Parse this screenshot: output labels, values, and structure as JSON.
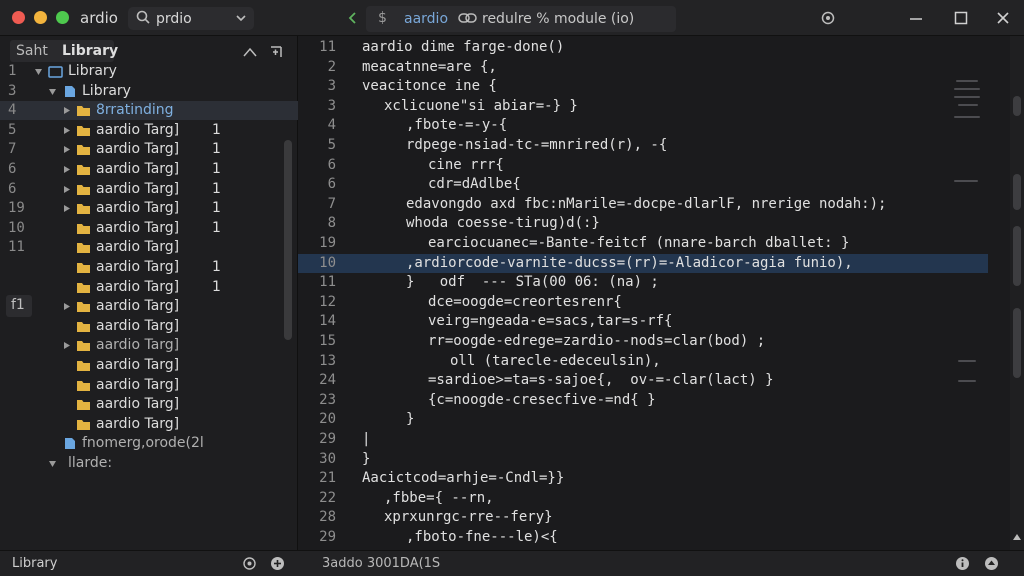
{
  "titlebar": {
    "app_name": "ardio",
    "search_value": "prdio",
    "tab_name": "aardio",
    "tab_description": "redulre % module (io)"
  },
  "sidebar": {
    "title_prefix": "Saht",
    "title": "Library",
    "marker": "f1",
    "rows": [
      {
        "num": "1",
        "label": "Library",
        "count": "",
        "indent": 0,
        "arrow": "down",
        "icon": "library-icon",
        "style": "normal"
      },
      {
        "num": "3",
        "label": "Library",
        "count": "",
        "indent": 1,
        "arrow": "down",
        "icon": "module-icon",
        "style": "normal"
      },
      {
        "num": "4",
        "label": "8rratinding",
        "count": "",
        "indent": 2,
        "arrow": "right",
        "icon": "folder-icon",
        "style": "blue"
      },
      {
        "num": "5",
        "label": "aardio Targ]",
        "count": "1",
        "indent": 2,
        "arrow": "right",
        "icon": "folder-icon",
        "style": "normal"
      },
      {
        "num": "7",
        "label": "aardio Targ]",
        "count": "1",
        "indent": 2,
        "arrow": "right",
        "icon": "folder-icon",
        "style": "normal"
      },
      {
        "num": "6",
        "label": "aardio Targ]",
        "count": "1",
        "indent": 2,
        "arrow": "right",
        "icon": "folder-icon",
        "style": "normal"
      },
      {
        "num": "6",
        "label": "aardio Targ]",
        "count": "1",
        "indent": 2,
        "arrow": "right",
        "icon": "folder-icon",
        "style": "normal"
      },
      {
        "num": "19",
        "label": "aardio Targ]",
        "count": "1",
        "indent": 2,
        "arrow": "right",
        "icon": "folder-icon",
        "style": "normal"
      },
      {
        "num": "10",
        "label": "aardio Targ]",
        "count": "1",
        "indent": 2,
        "arrow": "",
        "icon": "folder-icon",
        "style": "normal"
      },
      {
        "num": "11",
        "label": "aardio Targ]",
        "count": "",
        "indent": 2,
        "arrow": "",
        "icon": "folder-icon",
        "style": "normal"
      },
      {
        "num": "",
        "label": "aardio Targ]",
        "count": "1",
        "indent": 2,
        "arrow": "",
        "icon": "folder-icon",
        "style": "normal"
      },
      {
        "num": "",
        "label": "aardio Targ]",
        "count": "1",
        "indent": 2,
        "arrow": "",
        "icon": "folder-icon",
        "style": "normal"
      },
      {
        "num": "",
        "label": "aardio Targ]",
        "count": "",
        "indent": 2,
        "arrow": "right",
        "icon": "folder-icon",
        "style": "normal"
      },
      {
        "num": "",
        "label": "aardio Targ]",
        "count": "",
        "indent": 2,
        "arrow": "",
        "icon": "folder-icon",
        "style": "normal"
      },
      {
        "num": "",
        "label": "aardio Targ]",
        "count": "",
        "indent": 2,
        "arrow": "right",
        "icon": "folder-icon",
        "style": "dim"
      },
      {
        "num": "",
        "label": "aardio Targ]",
        "count": "",
        "indent": 2,
        "arrow": "",
        "icon": "folder-icon",
        "style": "normal"
      },
      {
        "num": "",
        "label": "aardio Targ]",
        "count": "",
        "indent": 2,
        "arrow": "",
        "icon": "folder-icon",
        "style": "normal"
      },
      {
        "num": "",
        "label": "aardio Targ]",
        "count": "",
        "indent": 2,
        "arrow": "",
        "icon": "folder-icon",
        "style": "normal"
      },
      {
        "num": "",
        "label": "aardio Targ]",
        "count": "",
        "indent": 2,
        "arrow": "",
        "icon": "folder-icon",
        "style": "normal"
      },
      {
        "num": "",
        "label": "fnomerg,orode(2l",
        "count": "",
        "indent": 1,
        "arrow": "",
        "icon": "module-icon",
        "style": "dim"
      },
      {
        "num": "",
        "label": "llarde:",
        "count": "",
        "indent": 1,
        "arrow": "down",
        "icon": "",
        "style": "dim"
      }
    ]
  },
  "editor": {
    "lines": [
      {
        "num": "11",
        "indent": 0,
        "text": "aardio dime farge-done()",
        "kind": "normal"
      },
      {
        "num": "2",
        "indent": 0,
        "text": "meacatnne=are {,",
        "kind": "kw"
      },
      {
        "num": "3",
        "indent": 0,
        "text": "veacitonce ine {",
        "kind": "normal"
      },
      {
        "num": "3",
        "indent": 1,
        "text": "xclicuone\"si abiar=-} }",
        "kind": "normal"
      },
      {
        "num": "4",
        "indent": 2,
        "text": ",fbote-=-y-{",
        "kind": "normal"
      },
      {
        "num": "5",
        "indent": 2,
        "text": "rdpege-nsiad-tc-=mnrired(r), -{",
        "kind": "normal"
      },
      {
        "num": "6",
        "indent": 3,
        "text": "cine rrr{",
        "kind": "normal"
      },
      {
        "num": "6",
        "indent": 3,
        "text": "cdr=dAdlbe{",
        "kind": "normal"
      },
      {
        "num": "7",
        "indent": 2,
        "text": "edavongdo axd fbc:nMarile=-docpe-dlarlF, nrerige nodah:);",
        "kind": "normal"
      },
      {
        "num": "8",
        "indent": 2,
        "text": "whoda coesse-tirug)d(:}",
        "kind": "normal"
      },
      {
        "num": "19",
        "indent": 3,
        "text": "earciocuanec=-Bante-feitcf (nnare-barch dballet: }",
        "kind": "fn"
      },
      {
        "num": "10",
        "indent": 2,
        "text": ",ardiorcode-varnite-ducss=(rr)=-Aladicor-agia funio),",
        "kind": "hl"
      },
      {
        "num": "11",
        "indent": 2,
        "text": "}   odf  --- STa(00 06: (na) ;",
        "kind": "normal"
      },
      {
        "num": "12",
        "indent": 3,
        "text": "dce=oogde=creortesrenr{",
        "kind": "normal"
      },
      {
        "num": "14",
        "indent": 3,
        "text": "veirg=ngeada-e=sacs,tar=s-rf{",
        "kind": "normal"
      },
      {
        "num": "15",
        "indent": 3,
        "text": "rr=oogde-edrege=zardio--nods=clar(bod) ;",
        "kind": "normal"
      },
      {
        "num": "13",
        "indent": 4,
        "text": "oll (tarecle-edeceulsin),",
        "kind": "normal"
      },
      {
        "num": "24",
        "indent": 3,
        "text": "=sardioe>=ta=s-sajoe{,  ov-=-clar(lact) }",
        "kind": "normal"
      },
      {
        "num": "23",
        "indent": 3,
        "text": "{c=noogde-cresecfive-=nd{ }",
        "kind": "normal"
      },
      {
        "num": "20",
        "indent": 2,
        "text": "}",
        "kind": "normal"
      },
      {
        "num": "29",
        "indent": 0,
        "text": "|",
        "kind": "normal"
      },
      {
        "num": "30",
        "indent": 0,
        "text": "}",
        "kind": "normal"
      },
      {
        "num": "21",
        "indent": 0,
        "text": "Aacictcod=arhje=-Cndl=}}",
        "kind": "normal"
      },
      {
        "num": "22",
        "indent": 1,
        "text": ",fbbe={ --rn,",
        "kind": "normal"
      },
      {
        "num": "28",
        "indent": 1,
        "text": "xprxunrgc-rre--fery}",
        "kind": "normal"
      },
      {
        "num": "29",
        "indent": 2,
        "text": ",fboto-fne---le)<{",
        "kind": "normal"
      },
      {
        "num": "39",
        "indent": 0,
        "text": "{  =carodic{",
        "kind": "normal"
      }
    ]
  },
  "statusbar": {
    "left": "Library",
    "middle": "3addo 3001DA(1S"
  },
  "colors": {
    "highlight_line": "#23364f",
    "accent_blue": "#79a7d8"
  }
}
